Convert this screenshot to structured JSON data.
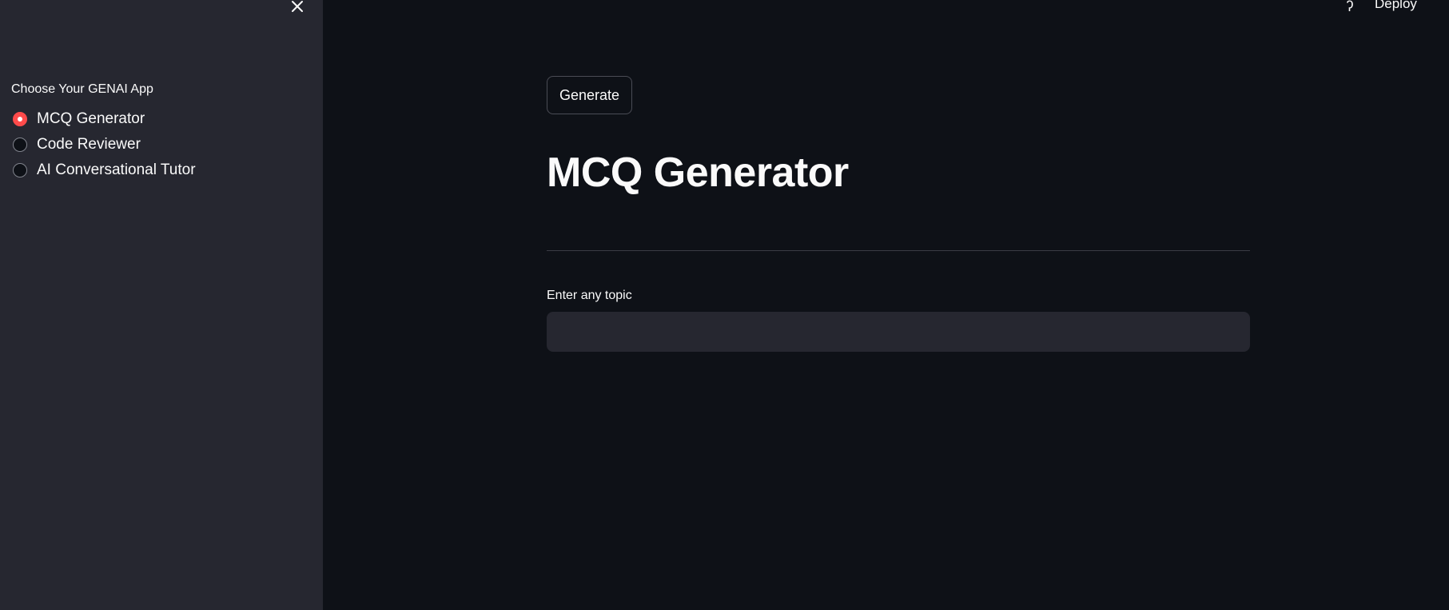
{
  "sidebar": {
    "close_icon": "close-icon",
    "radio_label": "Choose Your GENAI App",
    "options": [
      {
        "label": "MCQ Generator",
        "selected": true
      },
      {
        "label": "Code Reviewer",
        "selected": false
      },
      {
        "label": "AI Conversational Tutor",
        "selected": false
      }
    ],
    "selected_color": "#ff4b4b"
  },
  "header": {
    "help_icon": "help-icon",
    "help_glyph": "ʔ",
    "deploy_label": "Deploy"
  },
  "main": {
    "generate_label": "Generate",
    "title": "MCQ Generator",
    "input_label": "Enter any topic",
    "input_value": "",
    "input_placeholder": ""
  },
  "colors": {
    "background": "#0e1117",
    "sidebar_background": "#262730",
    "text": "#fafafa",
    "accent": "#ff4b4b"
  }
}
